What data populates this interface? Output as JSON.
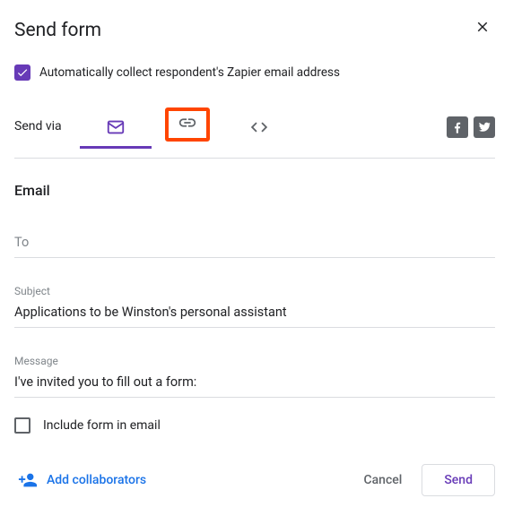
{
  "dialog": {
    "title": "Send form"
  },
  "collect": {
    "label": "Automatically collect respondent's Zapier email address",
    "checked": true
  },
  "sendVia": {
    "label": "Send via"
  },
  "section": {
    "email_title": "Email"
  },
  "fields": {
    "to_placeholder": "To",
    "to_value": "",
    "subject_label": "Subject",
    "subject_value": "Applications to be Winston's personal assistant",
    "message_label": "Message",
    "message_value": "I've invited you to fill out a form:"
  },
  "include": {
    "label": "Include form in email",
    "checked": false
  },
  "footer": {
    "add_collaborators": "Add collaborators",
    "cancel": "Cancel",
    "send": "Send"
  },
  "colors": {
    "accent": "#673ab7",
    "highlight_border": "#ff4500",
    "link": "#1a73e8"
  }
}
